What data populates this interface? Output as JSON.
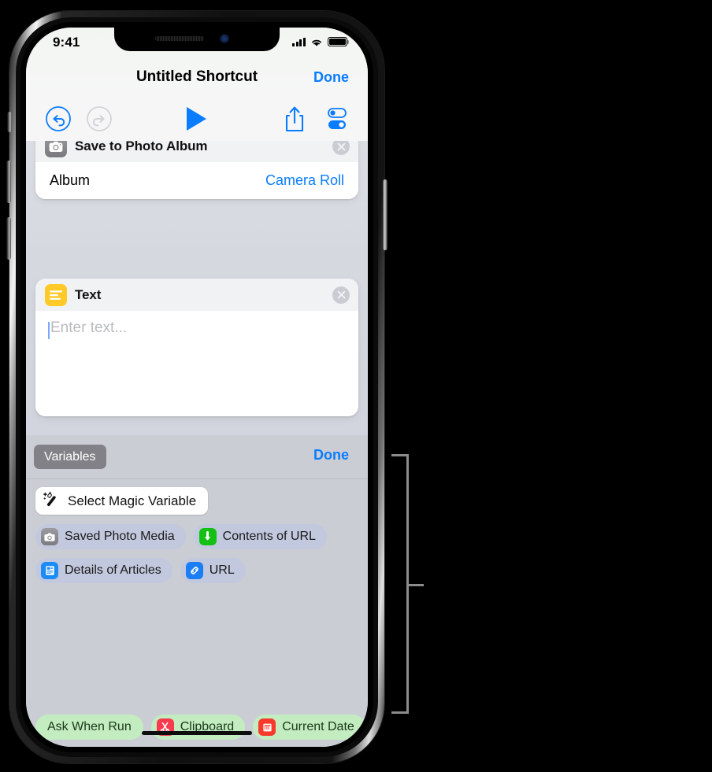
{
  "status_bar": {
    "time": "9:41",
    "cellular_icon": "cellular-signal-icon",
    "wifi_icon": "wifi-icon",
    "battery_icon": "battery-icon"
  },
  "nav": {
    "title": "Untitled Shortcut",
    "done_label": "Done"
  },
  "toolbar": {
    "undo_icon": "undo-icon",
    "redo_icon": "redo-icon",
    "play_icon": "play-icon",
    "share_icon": "share-icon",
    "settings_icon": "settings-toggles-icon"
  },
  "actions": [
    {
      "title": "Save to Photo Album",
      "icon": "camera-icon",
      "close_icon": "close-icon",
      "params": [
        {
          "label": "Album",
          "value": "Camera Roll"
        }
      ]
    },
    {
      "title": "Text",
      "icon": "text-lines-icon",
      "close_icon": "close-icon",
      "placeholder": "Enter text...",
      "value": ""
    }
  ],
  "variables_bar": {
    "title": "Variables",
    "done_label": "Done"
  },
  "variables_panel": {
    "magic_button": {
      "label": "Select Magic Variable",
      "icon": "magic-wand-icon"
    },
    "rows": [
      [
        {
          "label": "Saved Photo Media",
          "icon": "camera-icon",
          "style": "blue"
        },
        {
          "label": "Contents of URL",
          "icon": "download-arrow-icon",
          "style": "blue"
        }
      ],
      [
        {
          "label": "Details of Articles",
          "icon": "article-icon",
          "style": "blue"
        },
        {
          "label": "URL",
          "icon": "link-icon",
          "style": "blue"
        }
      ]
    ],
    "bottom_row": [
      {
        "label": "Ask When Run",
        "icon": "",
        "style": "green"
      },
      {
        "label": "Clipboard",
        "icon": "scissors-icon",
        "style": "green"
      },
      {
        "label": "Current Date",
        "icon": "calendar-icon",
        "style": "green"
      }
    ]
  },
  "colors": {
    "accent_blue": "#0a7cff",
    "panel_bg": "#cbcdd4",
    "chip_blue": "#c2c8dd",
    "chip_green": "#c3ecc0",
    "text_icon_yellow": "#ffc928"
  },
  "annotation": {
    "bracket": "callout-bracket"
  }
}
